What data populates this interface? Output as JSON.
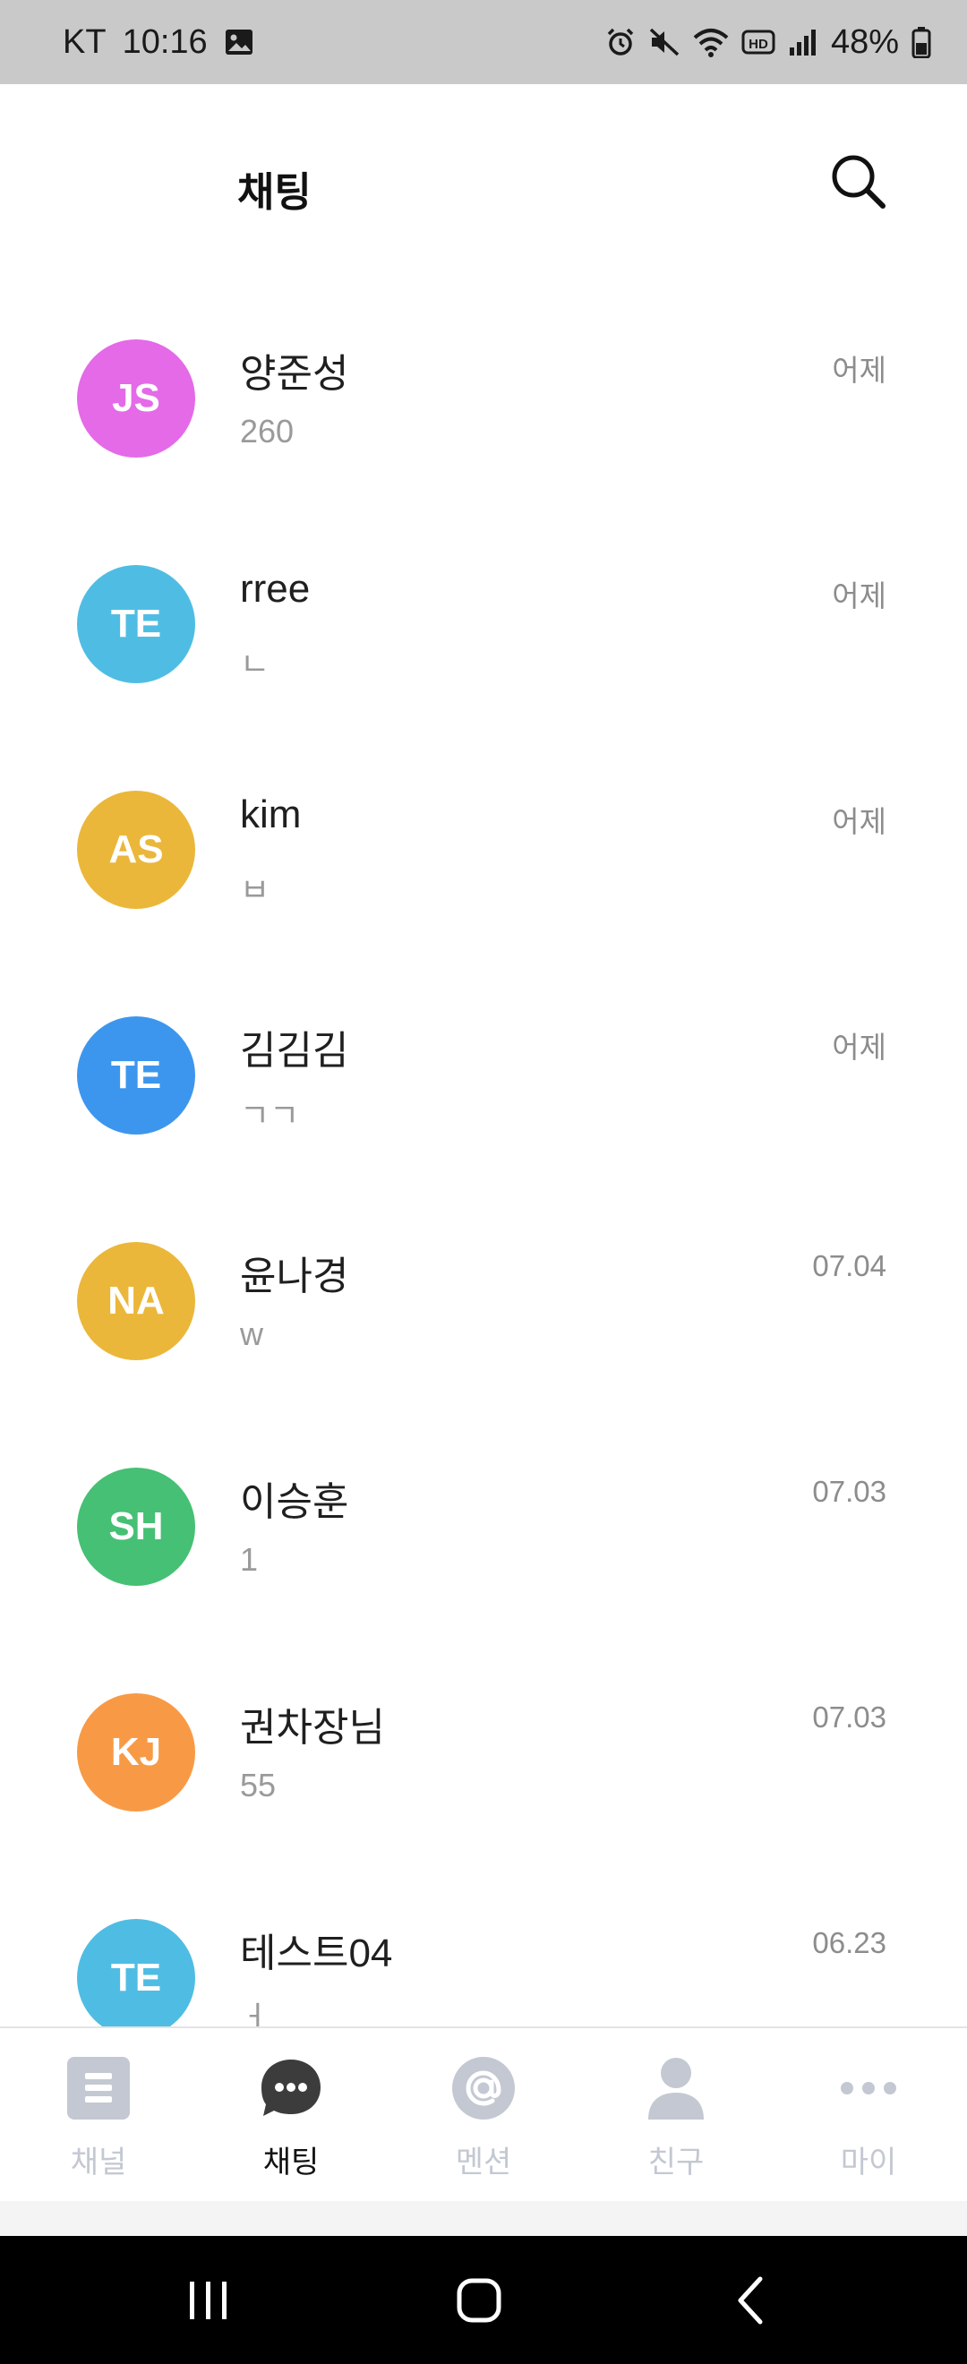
{
  "status_bar": {
    "carrier": "KT",
    "time": "10:16",
    "battery": "48%"
  },
  "header": {
    "title": "채팅"
  },
  "chats": [
    {
      "initials": "JS",
      "name": "양준성",
      "preview": "260",
      "time": "어제",
      "color": "#e46ae8"
    },
    {
      "initials": "TE",
      "name": "rree",
      "preview": "ㄴ",
      "time": "어제",
      "color": "#4fbde3"
    },
    {
      "initials": "AS",
      "name": "kim",
      "preview": "ㅂ",
      "time": "어제",
      "color": "#ebb73a"
    },
    {
      "initials": "TE",
      "name": "김김김",
      "preview": "ㄱㄱ",
      "time": "어제",
      "color": "#3d96ed"
    },
    {
      "initials": "NA",
      "name": "윤나경",
      "preview": "w",
      "time": "07.04",
      "color": "#ebb73a"
    },
    {
      "initials": "SH",
      "name": "이승훈",
      "preview": "1",
      "time": "07.03",
      "color": "#46c074"
    },
    {
      "initials": "KJ",
      "name": "권차장님",
      "preview": "55",
      "time": "07.03",
      "color": "#f89a45"
    },
    {
      "initials": "TE",
      "name": "테스트04",
      "preview": "ㅓ",
      "time": "06.23",
      "color": "#4fbde3"
    }
  ],
  "bottom_nav": [
    {
      "label": "채널",
      "icon": "channel-icon",
      "active": false
    },
    {
      "label": "채팅",
      "icon": "chat-icon",
      "active": true
    },
    {
      "label": "멘션",
      "icon": "mention-icon",
      "active": false
    },
    {
      "label": "친구",
      "icon": "friend-icon",
      "active": false
    },
    {
      "label": "마이",
      "icon": "more-icon",
      "active": false
    }
  ],
  "colors": {
    "nav_inactive": "#c3c8d2",
    "nav_active": "#3c3c3c"
  }
}
